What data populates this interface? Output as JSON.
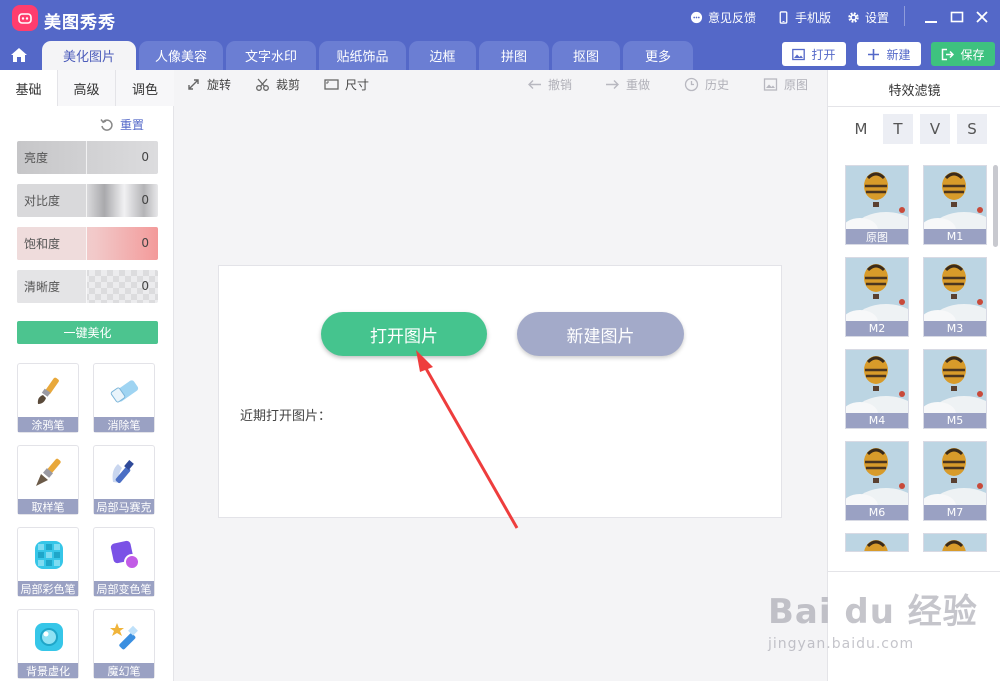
{
  "app": {
    "title": "美图秀秀"
  },
  "titlebar": {
    "feedback": "意见反馈",
    "mobile": "手机版",
    "settings": "设置"
  },
  "tabs": [
    {
      "label": "美化图片",
      "active": true
    },
    {
      "label": "人像美容"
    },
    {
      "label": "文字水印"
    },
    {
      "label": "贴纸饰品"
    },
    {
      "label": "边框"
    },
    {
      "label": "拼图"
    },
    {
      "label": "抠图"
    },
    {
      "label": "更多"
    }
  ],
  "top_buttons": {
    "open": "打开",
    "new": "新建",
    "save": "保存"
  },
  "left": {
    "subtabs": [
      "基础",
      "高级",
      "调色"
    ],
    "reset": "重置",
    "sliders": [
      {
        "label": "亮度",
        "value": "0"
      },
      {
        "label": "对比度",
        "value": "0"
      },
      {
        "label": "饱和度",
        "value": "0"
      },
      {
        "label": "清晰度",
        "value": "0"
      }
    ],
    "one_key": "一键美化",
    "tools": [
      {
        "label": "涂鸦笔",
        "icon": "brush-icon"
      },
      {
        "label": "消除笔",
        "icon": "eraser-icon"
      },
      {
        "label": "取样笔",
        "icon": "sample-brush-icon"
      },
      {
        "label": "局部马赛克",
        "icon": "mosaic-pen-icon"
      },
      {
        "label": "局部彩色笔",
        "icon": "color-pen-icon"
      },
      {
        "label": "局部变色笔",
        "icon": "recolor-pen-icon"
      },
      {
        "label": "背景虚化",
        "icon": "blur-icon"
      },
      {
        "label": "魔幻笔",
        "icon": "magic-pen-icon"
      }
    ]
  },
  "toolbar": {
    "rotate": "旋转",
    "crop": "裁剪",
    "size": "尺寸",
    "undo": "撤销",
    "redo": "重做",
    "history": "历史",
    "original": "原图"
  },
  "canvas": {
    "open_image": "打开图片",
    "new_image": "新建图片",
    "recent": "近期打开图片："
  },
  "right": {
    "title": "特效滤镜",
    "filter_tabs": [
      "M",
      "T",
      "V",
      "S"
    ],
    "filters": [
      "原图",
      "M1",
      "M2",
      "M3",
      "M4",
      "M5",
      "M6",
      "M7"
    ]
  },
  "watermark": {
    "main": "Bai du 经验",
    "sub": "jingyan.baidu.com"
  },
  "colors": {
    "header": "#5468c8",
    "tab": "#6b7ed3",
    "green": "#45c48e",
    "gray_button": "#a3aac9",
    "arrow": "#ee3d3d"
  }
}
